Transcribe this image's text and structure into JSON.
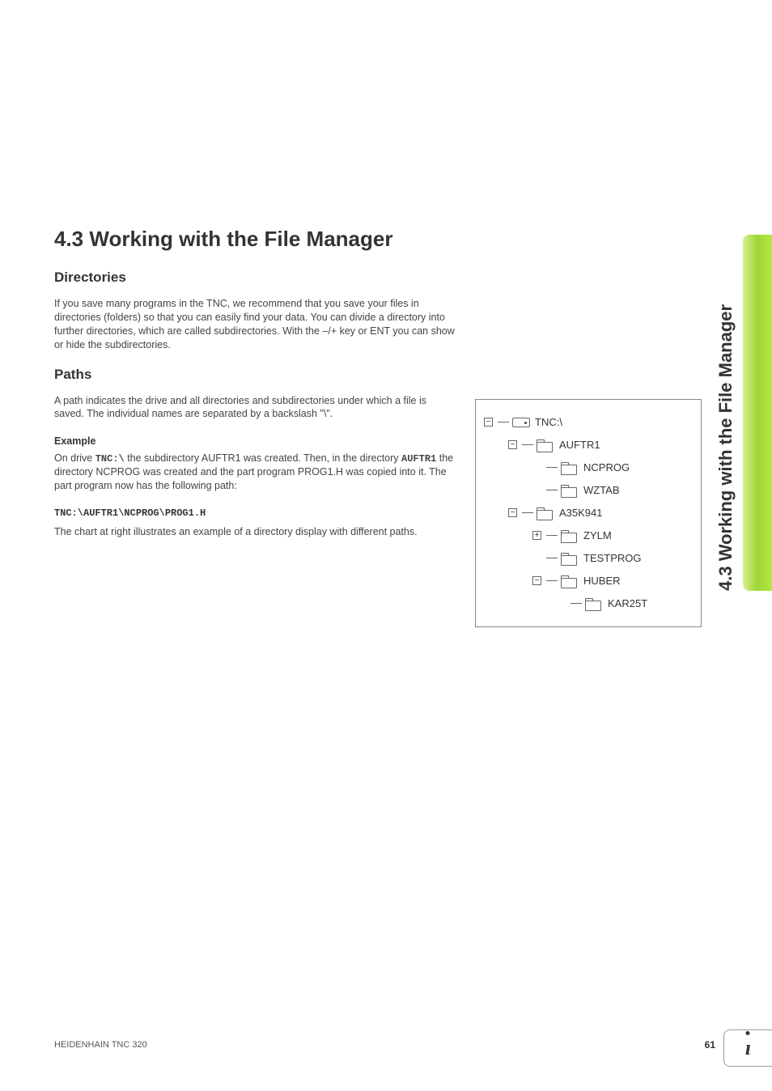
{
  "side_tab_text": "4.3 Working with the File Manager",
  "heading_main": "4.3  Working with the File Manager",
  "section_directories": {
    "title": "Directories",
    "body": "If you save many programs in the TNC, we recommend that you save your files in directories (folders) so that you can easily find your data. You can divide a directory into further directories, which are called subdirectories. With the –/+ key or ENT you can show or hide the subdirectories."
  },
  "section_paths": {
    "title": "Paths",
    "body": "A path indicates the drive and all directories and subdirectories under which a file is saved. The individual names are separated by a backslash \"\\\".",
    "example_label": "Example",
    "example_prefix1": "On drive ",
    "example_drive": "TNC:\\",
    "example_mid1": " the subdirectory AUFTR1 was created. Then, in the directory ",
    "example_dir": "AUFTR1",
    "example_mid2": " the directory NCPROG was created and the part program PROG1.H was copied into it. The part program now has the following path:",
    "example_path": "TNC:\\AUFTR1\\NCPROG\\PROG1.H",
    "example_closing": "The chart at right illustrates an example of a directory display with different paths."
  },
  "tree": {
    "root": "TNC:\\",
    "items": [
      {
        "label": "AUFTR1",
        "expander": "-"
      },
      {
        "label": "NCPROG",
        "expander": ""
      },
      {
        "label": "WZTAB",
        "expander": ""
      },
      {
        "label": "A35K941",
        "expander": "-"
      },
      {
        "label": "ZYLM",
        "expander": "+"
      },
      {
        "label": "TESTPROG",
        "expander": ""
      },
      {
        "label": "HUBER",
        "expander": "-"
      },
      {
        "label": "KAR25T",
        "expander": ""
      }
    ]
  },
  "footer": {
    "left": "HEIDENHAIN TNC 320",
    "right": "61"
  }
}
